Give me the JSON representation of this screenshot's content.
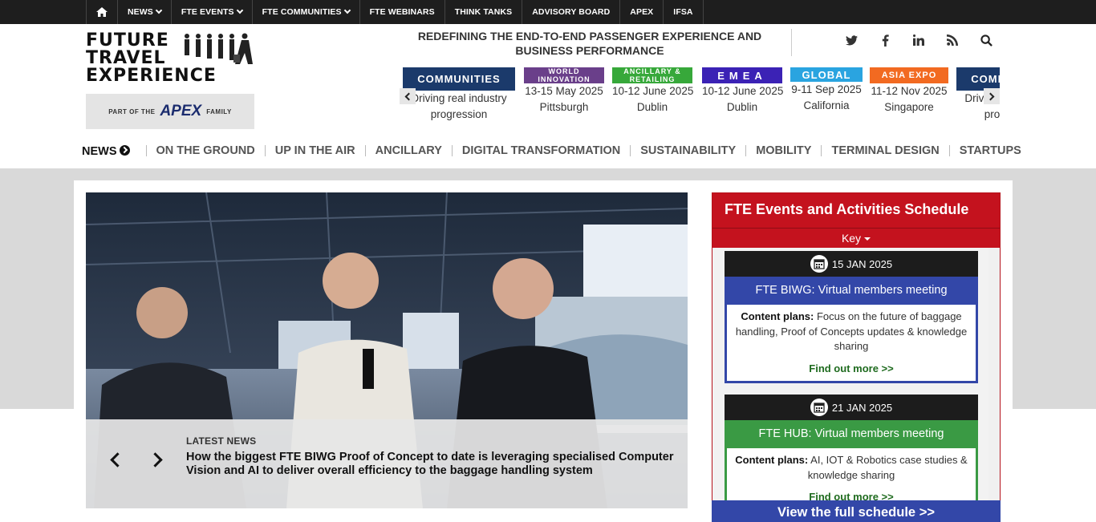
{
  "topnav": {
    "items": [
      {
        "label": "NEWS",
        "dropdown": true
      },
      {
        "label": "FTE EVENTS",
        "dropdown": true
      },
      {
        "label": "FTE COMMUNITIES",
        "dropdown": true
      },
      {
        "label": "FTE WEBINARS",
        "dropdown": false
      },
      {
        "label": "THINK TANKS",
        "dropdown": false
      },
      {
        "label": "ADVISORY BOARD",
        "dropdown": false
      },
      {
        "label": "APEX",
        "dropdown": false
      },
      {
        "label": "IFSA",
        "dropdown": false
      }
    ]
  },
  "logo": {
    "line1": "FUTURE",
    "line2": "TRAVEL",
    "line3": "EXPERIENCE"
  },
  "apex_badge": {
    "left": "PART OF THE",
    "brand": "APEX",
    "right": "FAMILY"
  },
  "tagline": "REDEFINING THE END-TO-END PASSENGER EXPERIENCE AND BUSINESS PERFORMANCE",
  "socials": [
    "twitter-icon",
    "facebook-icon",
    "linkedin-icon",
    "rss-icon",
    "search-icon"
  ],
  "carousel": {
    "events": [
      {
        "badge": "COMMUNITIES",
        "color": "#1b3a6b",
        "l1": "Driving real industry",
        "l2": "progression"
      },
      {
        "badge": "WORLD INNOVATION",
        "color": "#6a3f8a",
        "l1": "13-15 May 2025",
        "l2": "Pittsburgh"
      },
      {
        "badge": "ANCILLARY & RETAILING",
        "color": "#37a83a",
        "l1": "10-12 June 2025",
        "l2": "Dublin"
      },
      {
        "badge": "EMEA",
        "color": "#3b22b5",
        "l1": "10-12 June 2025",
        "l2": "Dublin"
      },
      {
        "badge": "GLOBAL",
        "color": "#2aa4e0",
        "l1": "9-11 Sep 2025",
        "l2": "California"
      },
      {
        "badge": "ASIA EXPO",
        "color": "#f26a21",
        "l1": "11-12 Nov 2025",
        "l2": "Singapore"
      },
      {
        "badge": "COMMUNITIES",
        "color": "#1b3a6b",
        "l1": "Driving real industry",
        "l2": "progression"
      }
    ]
  },
  "mainnav": {
    "items": [
      "NEWS",
      "ON THE GROUND",
      "UP IN THE AIR",
      "ANCILLARY",
      "DIGITAL TRANSFORMATION",
      "SUSTAINABILITY",
      "MOBILITY",
      "TERMINAL DESIGN",
      "STARTUPS"
    ]
  },
  "hero": {
    "label": "LATEST NEWS",
    "headline": "How the biggest FTE BIWG Proof of Concept to date is leveraging specialised Computer Vision and AI to deliver overall efficiency to the baggage handling system"
  },
  "schedule": {
    "title": "FTE Events and Activities Schedule",
    "key_label": "Key",
    "events": [
      {
        "date": "15 JAN 2025",
        "title": "FTE BIWG: Virtual members meeting",
        "color": "#3347a8",
        "plans_label": "Content plans:",
        "plans": "Focus on the future of baggage handling, Proof of Concepts updates & knowledge sharing",
        "more": "Find out more >>"
      },
      {
        "date": "21 JAN 2025",
        "title": "FTE HUB: Virtual members meeting",
        "color": "#3a9a44",
        "plans_label": "Content plans:",
        "plans": "AI, IOT & Robotics case studies & knowledge sharing",
        "more": "Find out more >>"
      }
    ],
    "button": "View the full schedule >>"
  }
}
